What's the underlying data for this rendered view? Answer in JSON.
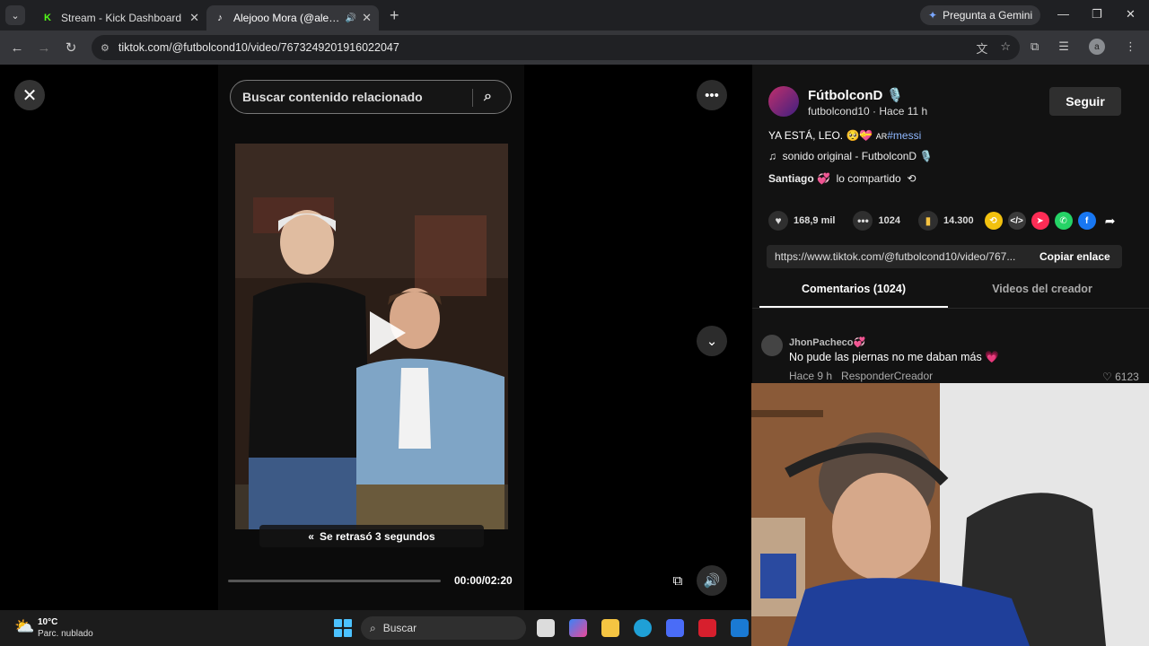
{
  "browser": {
    "tabs": [
      {
        "title": "Stream - Kick Dashboard",
        "active": false,
        "favicon": "kick-icon",
        "color": "#53fc18"
      },
      {
        "title": "Alejooo Mora (@alejandron...",
        "active": true,
        "favicon": "tiktok-icon",
        "color": "#ffffff"
      }
    ],
    "new_tab": "+",
    "gemini_label": "Pregunta a Gemini",
    "url": "tiktok.com/@futbolcond10/video/7673249201916022047",
    "window_controls": [
      "minimize-icon",
      "restore-icon",
      "close-icon"
    ]
  },
  "video": {
    "search_placeholder": "Buscar contenido relacionado",
    "rewind_text": "Se retrasó 3 segundos",
    "rewind_icon": "«",
    "time": "00:00/02:20",
    "progress": 0
  },
  "creator": {
    "name": "FútbolconD 🎙️",
    "meta": "futbolcond10 · Hace 11 h",
    "follow_label": "Seguir"
  },
  "post": {
    "caption_text": "YA ESTÁ, LEO. 🥺💝 ",
    "caption_flag": "AR",
    "caption_tag": "#messi",
    "sound": "sonido original - FutbolconD 🎙️",
    "shared_user": "Santiago 💞",
    "shared_text": "lo compartido"
  },
  "actions": {
    "likes": "168,9 mil",
    "comments": "1024",
    "saves": "14.300"
  },
  "link": {
    "url": "https://www.tiktok.com/@futbolcond10/video/767...",
    "copy_label": "Copiar enlace"
  },
  "tabs": {
    "comments": "Comentarios (1024)",
    "creator_videos": "Videos del creador"
  },
  "comment": {
    "user": "JhonPacheco💞",
    "text": "No pude las piernas no me daban más 💗",
    "time": "Hace 9 h",
    "reply": "Responder",
    "creator_badge": "Creador",
    "likes": "6123"
  },
  "taskbar": {
    "temp": "10°C",
    "weather": "Parc. nublado",
    "search": "Buscar"
  }
}
